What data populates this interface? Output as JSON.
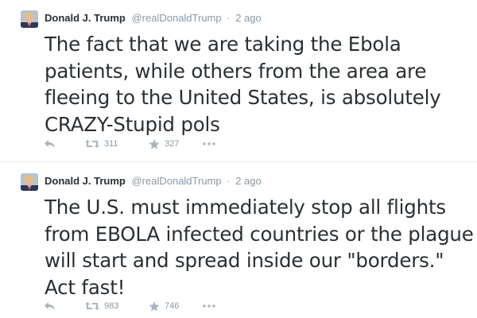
{
  "tweets": [
    {
      "fullname": "Donald J. Trump",
      "username": "@realDonaldTrump",
      "separator": "·",
      "time": "2 ago",
      "text": "The fact that we are taking the Ebola patients, while others from the area are fleeing to the United States, is absolutely CRAZY-Stupid pols",
      "retweets": "311",
      "favorites": "327"
    },
    {
      "fullname": "Donald J. Trump",
      "username": "@realDonaldTrump",
      "separator": "·",
      "time": "2 ago",
      "text": "The U.S. must immediately stop all flights from EBOLA infected countries or the plague will start and spread inside our \"borders.\" Act fast!",
      "retweets": "983",
      "favorites": "746"
    }
  ],
  "icons": {
    "reply": "reply-icon",
    "retweet": "retweet-icon",
    "favorite": "star-icon",
    "more": "more-icon"
  },
  "colors": {
    "text": "#292f33",
    "meta": "#8899a6",
    "divider": "#e1e8ed",
    "background": "#ffffff"
  }
}
